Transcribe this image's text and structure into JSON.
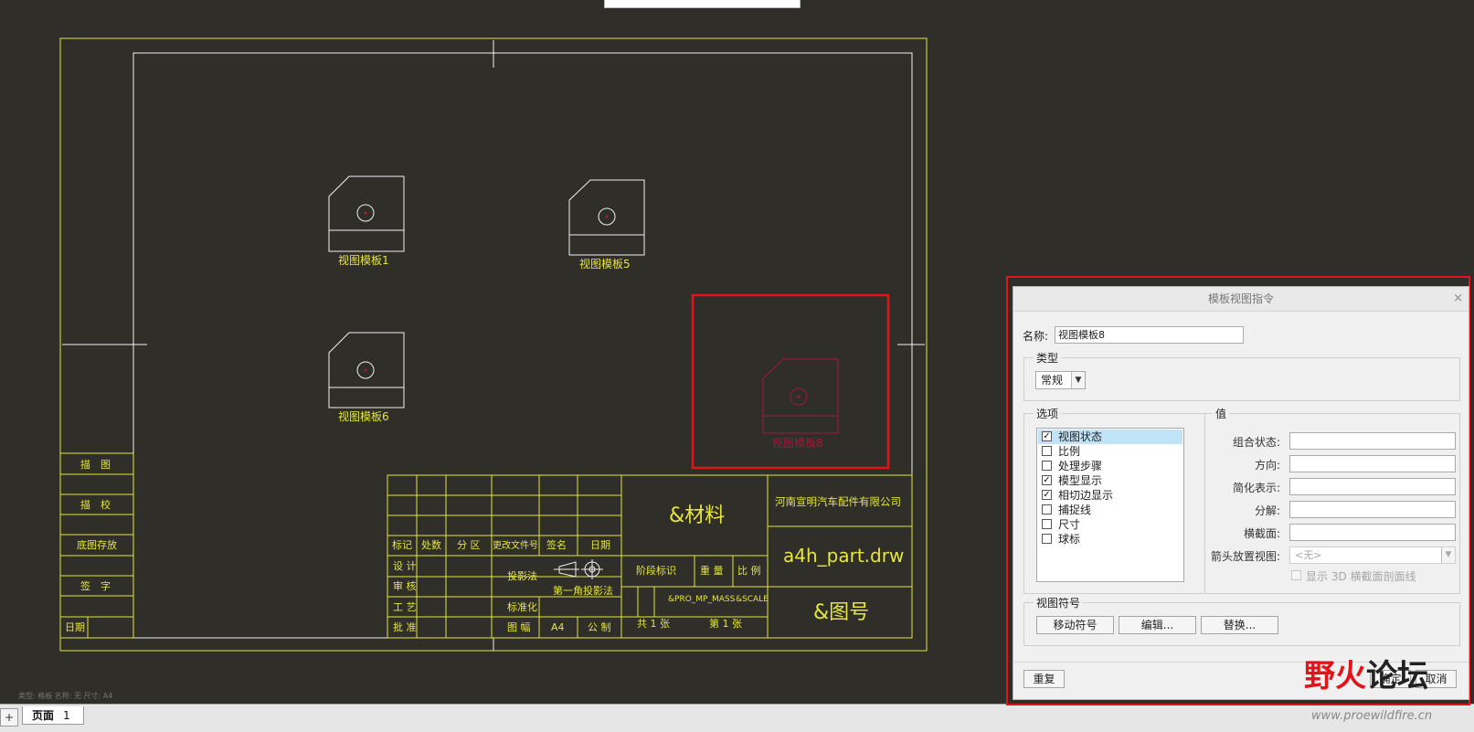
{
  "drawing": {
    "views": [
      {
        "label": "视图模板1"
      },
      {
        "label": "视图模板5"
      },
      {
        "label": "视图模板6"
      },
      {
        "label": "视图模板8"
      }
    ],
    "left_block": [
      "描　图",
      "描　校",
      "底图存放",
      "签　字",
      "日期"
    ],
    "title_block": {
      "headers": [
        "标记",
        "处数",
        "分 区",
        "更改文件号",
        "签名",
        "日期"
      ],
      "rows": [
        "设 计",
        "审 核",
        "工 艺",
        "批 准"
      ],
      "projection": "投影法",
      "projection_label": "第一角投影法",
      "standardization": "标准化",
      "sheet_size_label": "图 幅",
      "sheet_size": "A4",
      "unit": "公 制",
      "material": "&材料",
      "company": "河南宣明汽车配件有限公司",
      "drawing_name": "a4h_part.drw",
      "drawing_number": "&图号",
      "stage_mark": "阶段标识",
      "weight": "重 量",
      "scale_label": "比 例",
      "scale_param": "&PRO_MP_MASS",
      "scale_value": "&SCALE",
      "total_sheets": "共 1 张",
      "sheet_no": "第 1 张"
    },
    "status_line": "类型:  格板    名称:  无    尺寸:  A4"
  },
  "tabs": {
    "add": "+",
    "page_label": "页面",
    "page_number": "1"
  },
  "dialog": {
    "title": "模板视图指令",
    "close": "×",
    "name_label": "名称:",
    "name_value": "视图模板8",
    "type_group": "类型",
    "type_value": "常规",
    "options_group": "选项",
    "values_group": "值",
    "options": [
      {
        "label": "视图状态",
        "checked": true,
        "selected": true
      },
      {
        "label": "比例",
        "checked": false
      },
      {
        "label": "处理步骤",
        "checked": false
      },
      {
        "label": "模型显示",
        "checked": true
      },
      {
        "label": "相切边显示",
        "checked": true
      },
      {
        "label": "捕捉线",
        "checked": false
      },
      {
        "label": "尺寸",
        "checked": false
      },
      {
        "label": "球标",
        "checked": false
      }
    ],
    "values": [
      {
        "label": "组合状态:"
      },
      {
        "label": "方向:"
      },
      {
        "label": "简化表示:"
      },
      {
        "label": "分解:"
      },
      {
        "label": "横截面:"
      }
    ],
    "arrow_view_label": "箭头放置视图:",
    "arrow_view_value": "<无>",
    "show_3d_label": "显示 3D 横截面剖面线",
    "symbol_group": "视图符号",
    "btn_move": "移动符号",
    "btn_edit": "编辑...",
    "btn_replace": "替换...",
    "btn_reset": "重复",
    "btn_ok": "确定",
    "btn_cancel": "取消"
  },
  "watermark": {
    "text_a": "野火",
    "text_b": "论坛",
    "url": "www.proewildfire.cn"
  },
  "colors": {
    "background": "#2f2e29",
    "border_yellow": "#e6e63c",
    "view_white": "#ffffff",
    "selected_red": "#e2141b",
    "selected_view": "#a3183a"
  }
}
